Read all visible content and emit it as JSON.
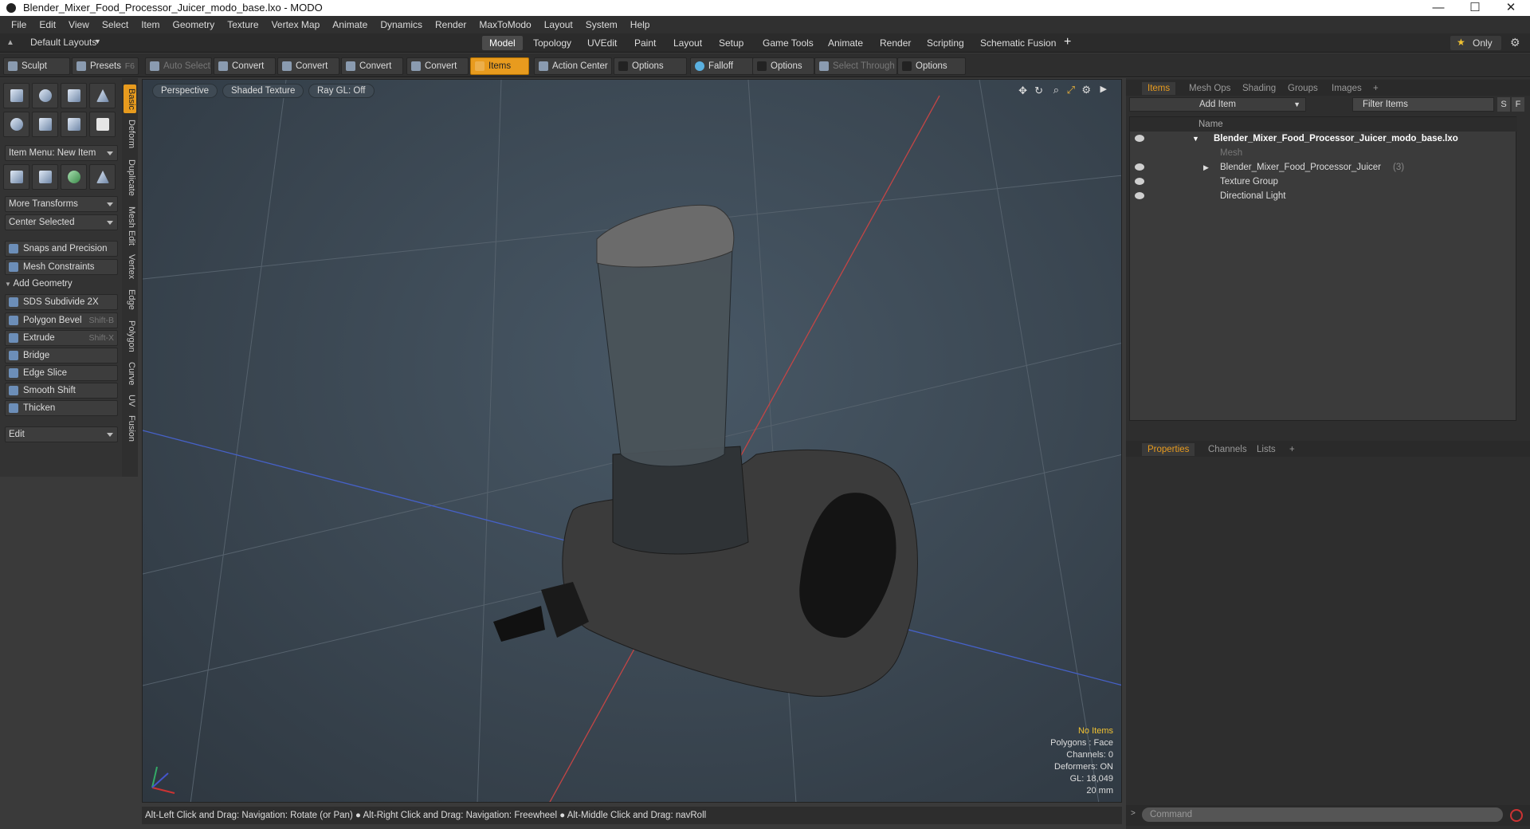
{
  "window": {
    "title": "Blender_Mixer_Food_Processor_Juicer_modo_base.lxo - MODO",
    "minimize": "—",
    "maximize": "☐",
    "close": "✕"
  },
  "menu": [
    "File",
    "Edit",
    "View",
    "Select",
    "Item",
    "Geometry",
    "Texture",
    "Vertex Map",
    "Animate",
    "Dynamics",
    "Render",
    "MaxToModo",
    "Layout",
    "System",
    "Help"
  ],
  "layouts": {
    "label": "Default Layouts",
    "tabs": [
      "Model",
      "Topology",
      "UVEdit",
      "Paint",
      "Layout",
      "Setup",
      "Game Tools",
      "Animate",
      "Render",
      "Scripting",
      "Schematic Fusion"
    ],
    "active": "Model",
    "plus": "+",
    "only": "Only"
  },
  "toolbar": {
    "sculpt": "Sculpt",
    "presets": "Presets",
    "presets_key": "F6",
    "auto_select": "Auto Select",
    "convert1": "Convert",
    "convert2": "Convert",
    "convert3": "Convert",
    "convert4": "Convert",
    "items": "Items",
    "action_center": "Action Center",
    "options1": "Options",
    "falloff": "Falloff",
    "options2": "Options",
    "select_through": "Select Through",
    "options3": "Options"
  },
  "left": {
    "item_menu": "Item Menu: New Item",
    "more_transforms": "More Transforms",
    "center_selected": "Center Selected",
    "snaps": "Snaps and Precision",
    "mesh_constraints": "Mesh Constraints",
    "add_geometry": "Add Geometry",
    "sds": "SDS Subdivide 2X",
    "polygon_bevel": "Polygon Bevel",
    "polygon_bevel_key": "Shift-B",
    "extrude": "Extrude",
    "extrude_key": "Shift-X",
    "bridge": "Bridge",
    "edge_slice": "Edge Slice",
    "smooth_shift": "Smooth Shift",
    "thicken": "Thicken",
    "edit": "Edit"
  },
  "vtabs": [
    "Basic",
    "Deform",
    "Duplicate",
    "Mesh Edit",
    "Vertex",
    "Edge",
    "Polygon",
    "Curve",
    "UV",
    "Fusion"
  ],
  "viewport": {
    "perspective": "Perspective",
    "shading": "Shaded Texture",
    "raygl": "Ray GL: Off",
    "stats": {
      "items": "No Items",
      "polygons": "Polygons : Face",
      "channels": "Channels: 0",
      "deformers": "Deformers: ON",
      "gl": "GL: 18,049",
      "scale": "20 mm"
    }
  },
  "status": "Alt-Left Click and Drag: Navigation: Rotate (or Pan) ● Alt-Right Click and Drag: Navigation: Freewheel ● Alt-Middle Click and Drag: navRoll",
  "right": {
    "tabs": [
      "Items",
      "Mesh Ops",
      "Shading",
      "Groups",
      "Images"
    ],
    "add_item": "Add Item",
    "filter": "Filter Items",
    "s": "S",
    "f": "F",
    "col_name": "Name",
    "items": [
      {
        "name": "Blender_Mixer_Food_Processor_Juicer_modo_base.lxo",
        "extra": ""
      },
      {
        "name": "Mesh",
        "extra": ""
      },
      {
        "name": "Blender_Mixer_Food_Processor_Juicer",
        "extra": "(3)"
      },
      {
        "name": "Texture Group",
        "extra": ""
      },
      {
        "name": "Directional Light",
        "extra": ""
      }
    ],
    "prop_tabs": [
      "Properties",
      "Channels",
      "Lists"
    ],
    "command": "Command"
  }
}
